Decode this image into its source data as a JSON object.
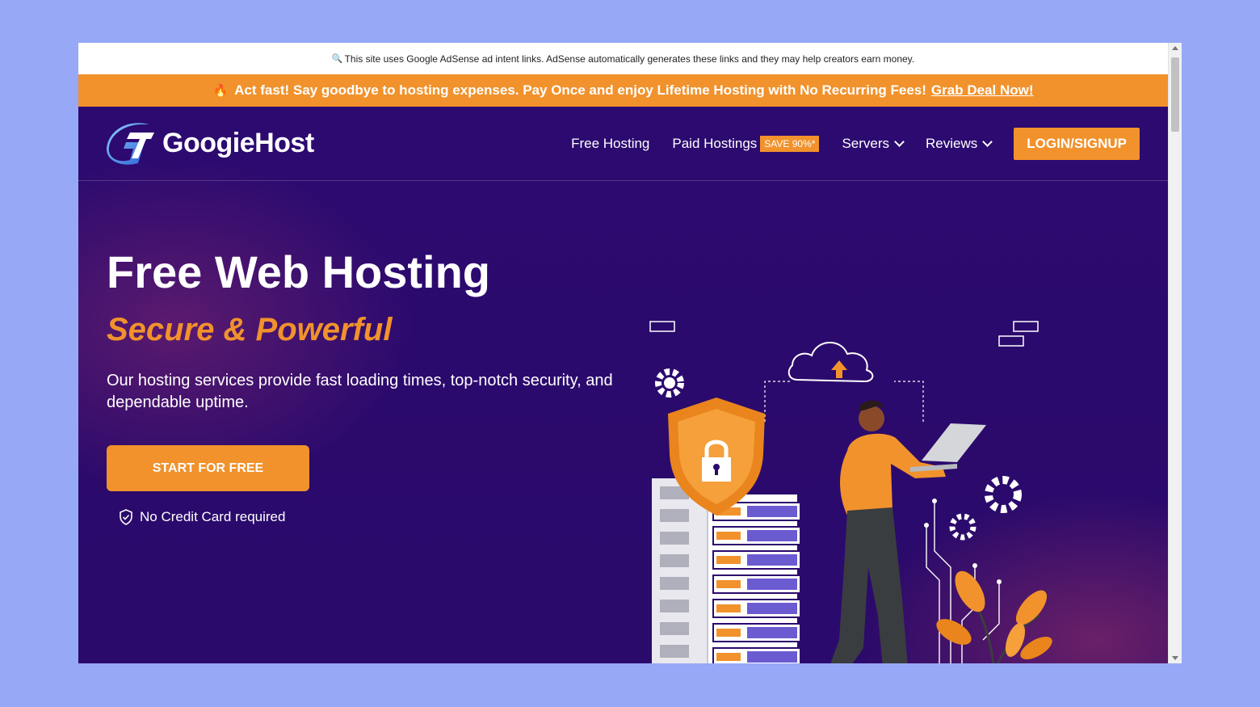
{
  "adsense_notice": {
    "icon": "search-icon",
    "text": "This site uses Google AdSense ad intent links. AdSense automatically generates these links and they may help creators earn money."
  },
  "promo": {
    "icon": "fire-icon",
    "text": "Act fast! Say goodbye to hosting expenses. Pay Once and enjoy Lifetime Hosting with No Recurring Fees!",
    "link": "Grab Deal Now!"
  },
  "brand": {
    "name": "GoogieHost"
  },
  "nav": {
    "free_hosting": "Free Hosting",
    "paid_hostings": "Paid Hostings",
    "save_badge": "SAVE 90%*",
    "servers": "Servers",
    "reviews": "Reviews",
    "login": "LOGIN/SIGNUP"
  },
  "hero": {
    "title": "Free Web Hosting",
    "subtitle": "Secure & Powerful",
    "description": "Our hosting services provide fast loading times, top-notch security, and dependable uptime.",
    "cta": "START FOR FREE",
    "no_credit": "No Credit Card required"
  },
  "colors": {
    "accent": "#f1922c",
    "background": "#2a0a6e",
    "page_bg": "#97a8f7"
  }
}
